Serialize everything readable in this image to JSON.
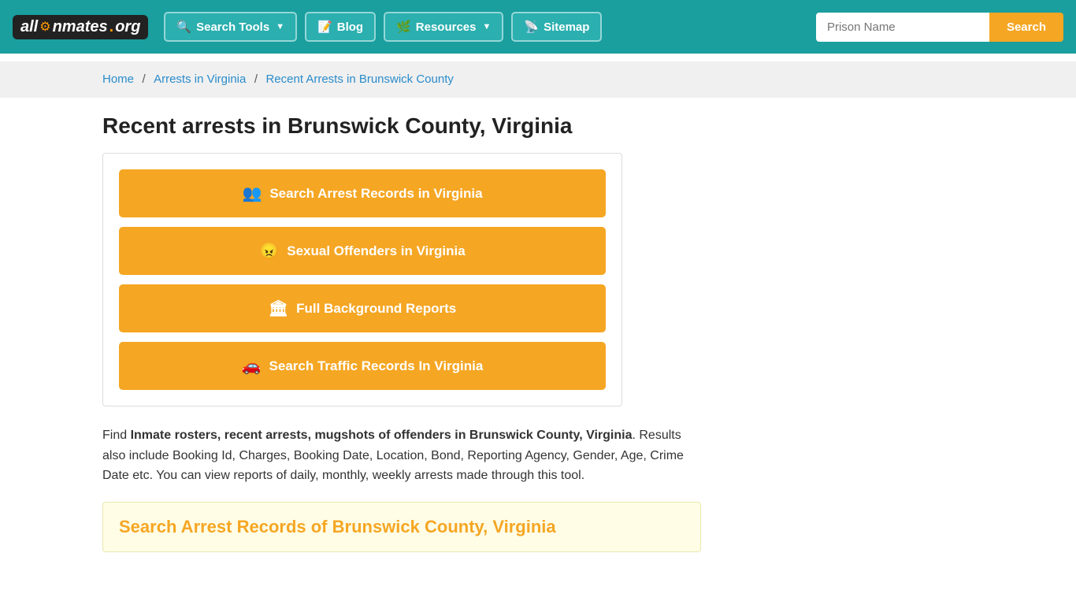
{
  "navbar": {
    "logo": {
      "part1": "all",
      "part2": "Inmates",
      "part3": ".org"
    },
    "nav_items": [
      {
        "label": "Search Tools",
        "icon": "🔍",
        "has_caret": true,
        "id": "search-tools"
      },
      {
        "label": "Blog",
        "icon": "📝",
        "has_caret": false,
        "id": "blog"
      },
      {
        "label": "Resources",
        "icon": "🌿",
        "has_caret": true,
        "id": "resources"
      },
      {
        "label": "Sitemap",
        "icon": "📡",
        "has_caret": false,
        "id": "sitemap"
      }
    ],
    "prison_input_placeholder": "Prison Name",
    "search_btn_label": "Search"
  },
  "breadcrumb": {
    "home": "Home",
    "arrests": "Arrests in Virginia",
    "current": "Recent Arrests in Brunswick County"
  },
  "page": {
    "title": "Recent arrests in Brunswick County, Virginia",
    "buttons": [
      {
        "label": "Search Arrest Records in Virginia",
        "icon": "👥",
        "id": "btn-arrest"
      },
      {
        "label": "Sexual Offenders in Virginia",
        "icon": "😠",
        "id": "btn-offenders"
      },
      {
        "label": "Full Background Reports",
        "icon": "🏛",
        "id": "btn-background"
      },
      {
        "label": "Search Traffic Records In Virginia",
        "icon": "🚗",
        "id": "btn-traffic"
      }
    ],
    "description_pre": "Find ",
    "description_bold": "Inmate rosters, recent arrests, mugshots of offenders in Brunswick County, Virginia",
    "description_post": ". Results also include Booking Id, Charges, Booking Date, Location, Bond, Reporting Agency, Gender, Age, Crime Date etc. You can view reports of daily, monthly, weekly arrests made through this tool.",
    "search_records_title": "Search Arrest Records of Brunswick County, Virginia"
  }
}
